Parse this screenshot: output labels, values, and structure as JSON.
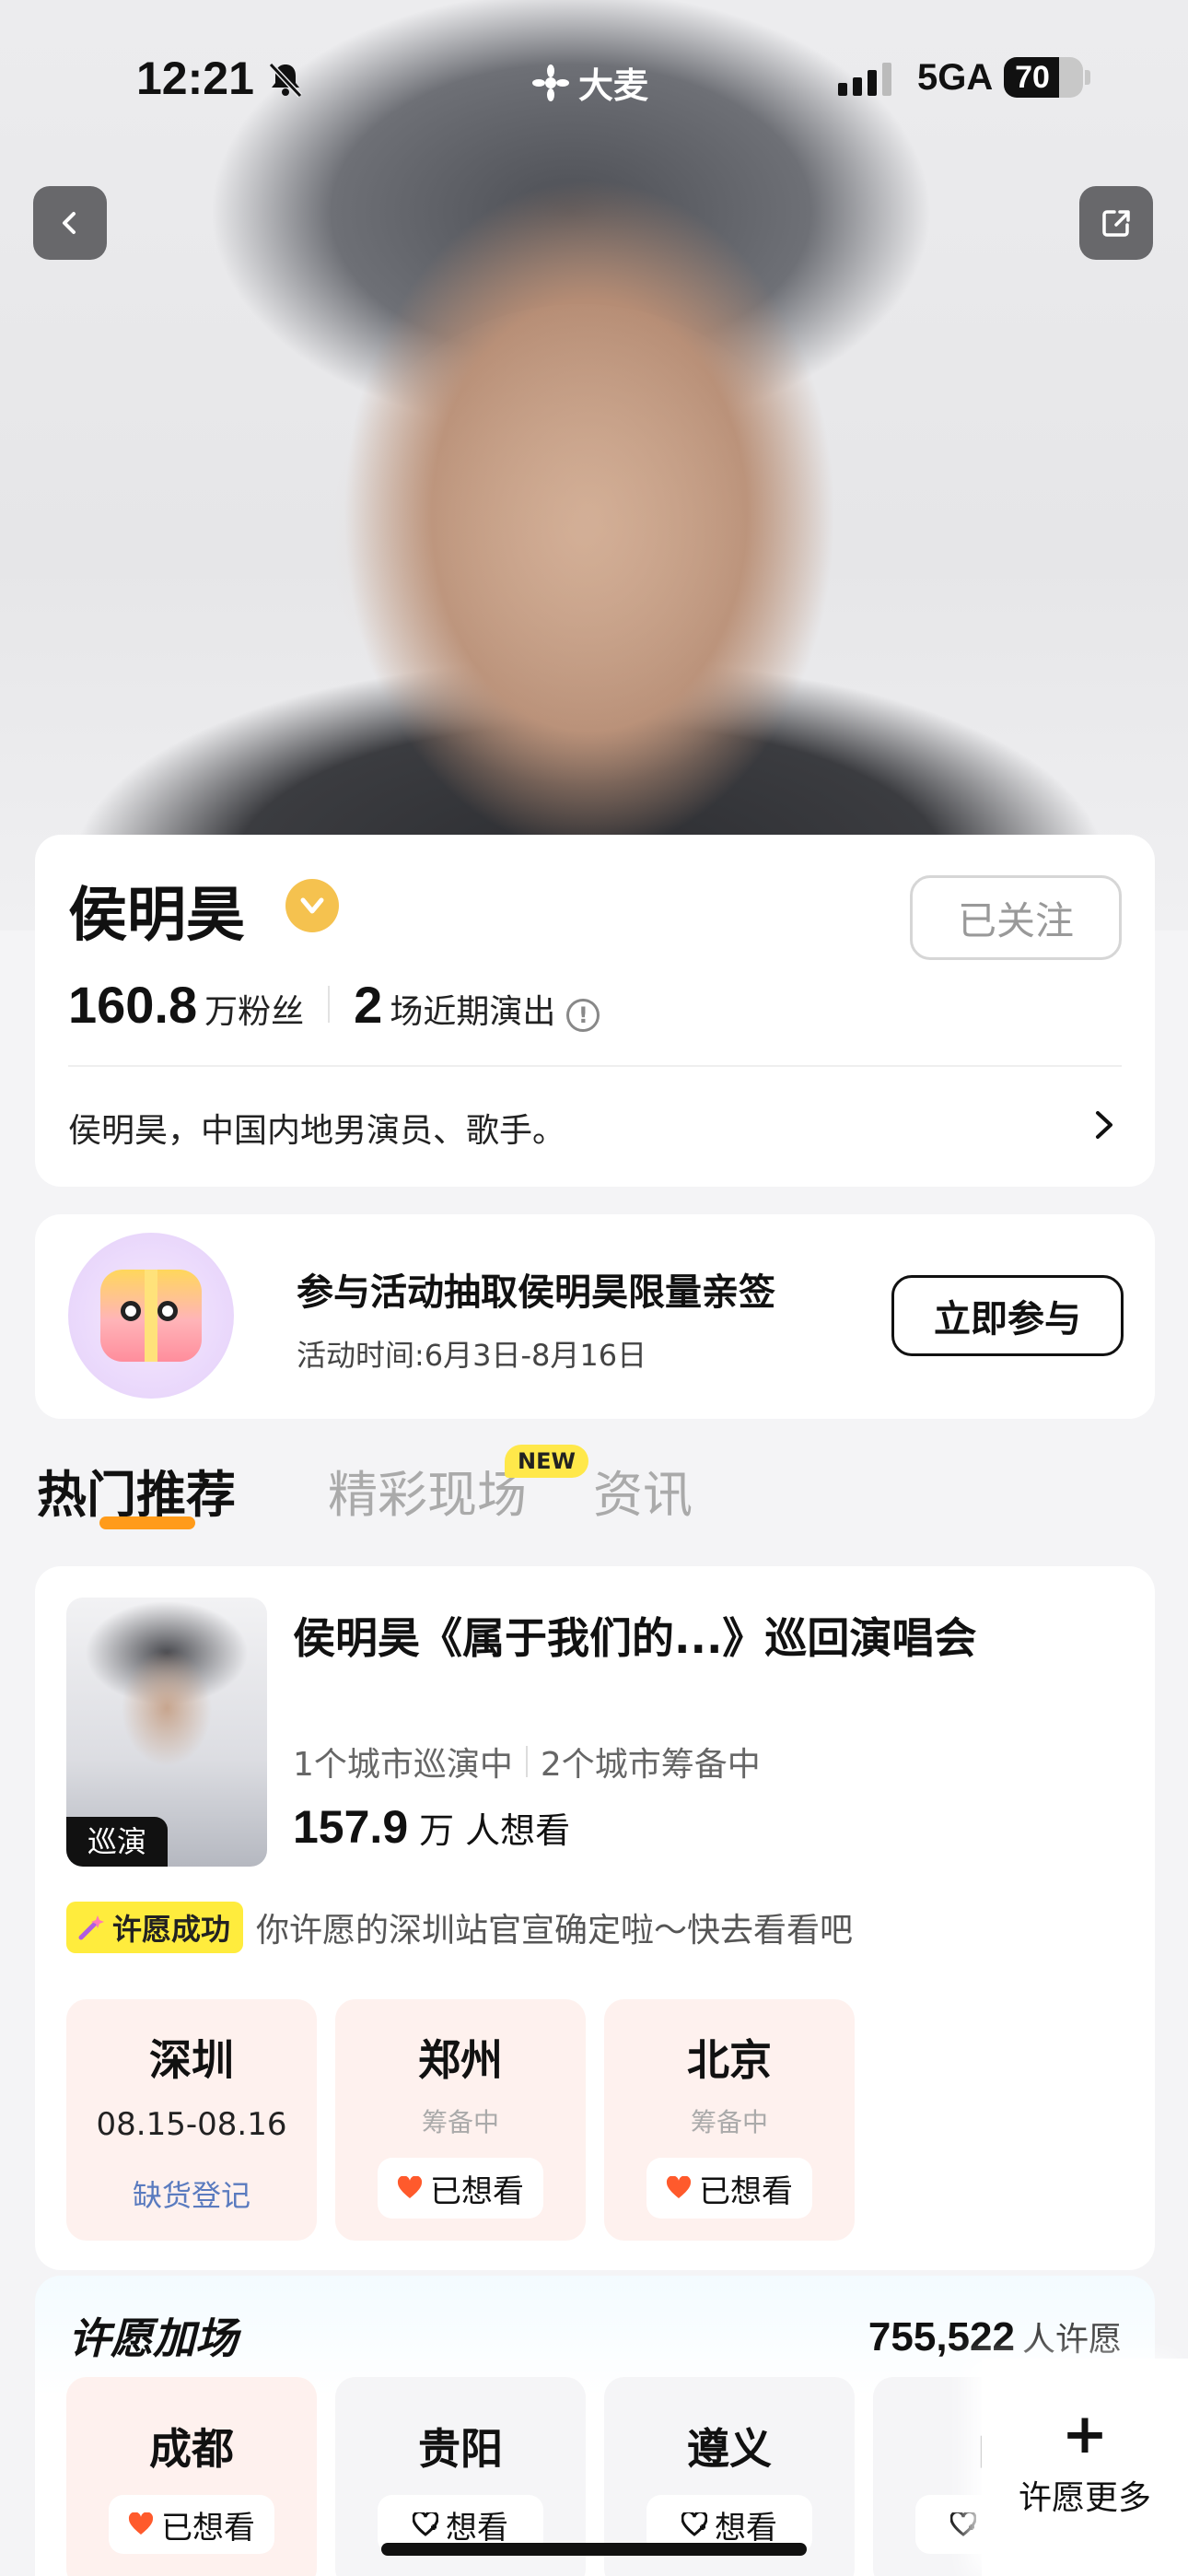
{
  "status_bar": {
    "time": "12:21",
    "brand": "大麦",
    "network": "5GA",
    "battery": "70",
    "battery_level": 0.7
  },
  "artist": {
    "name": "侯明昊",
    "follow_label": "已关注",
    "fans_number": "160.8",
    "fans_label": "万粉丝",
    "shows_number": "2",
    "shows_label": "场近期演出",
    "bio": "侯明昊，中国内地男演员、歌手。"
  },
  "promo": {
    "title": "参与活动抽取侯明昊限量亲签",
    "time": "活动时间:6月3日-8月16日",
    "button": "立即参与"
  },
  "tabs": [
    {
      "label": "热门推荐",
      "active": true
    },
    {
      "label": "精彩现场",
      "badge": "NEW"
    },
    {
      "label": "资讯"
    }
  ],
  "show": {
    "poster_tag": "巡演",
    "title": "侯明昊《属于我们的...》巡回演唱会",
    "touring": "1个城市巡演中",
    "preparing": "2个城市筹备中",
    "want_number": "157.9",
    "want_unit": "万",
    "want_label": "人想看",
    "wish_badge": "许愿成功",
    "wish_text": "你许愿的深圳站官宣确定啦～快去看看吧",
    "cities": [
      {
        "name": "深圳",
        "date": "08.15-08.16",
        "action": "缺货登记"
      },
      {
        "name": "郑州",
        "status": "筹备中",
        "action": "已想看"
      },
      {
        "name": "北京",
        "status": "筹备中",
        "action": "已想看"
      }
    ]
  },
  "wish": {
    "title": "许愿加场",
    "count": "755,522",
    "count_label": "人许愿",
    "cities": [
      {
        "name": "成都",
        "action": "已想看"
      },
      {
        "name": "贵阳",
        "action": "想看"
      },
      {
        "name": "遵义",
        "action": "想看"
      },
      {
        "name": "曲",
        "action": "想看"
      }
    ],
    "more_label": "许愿更多"
  },
  "colors": {
    "accent": "#ff9b1a",
    "heart": "#ff5a2c",
    "link": "#5a7bbf",
    "tile": "#fef1ee",
    "badge": "#ffec3d"
  }
}
